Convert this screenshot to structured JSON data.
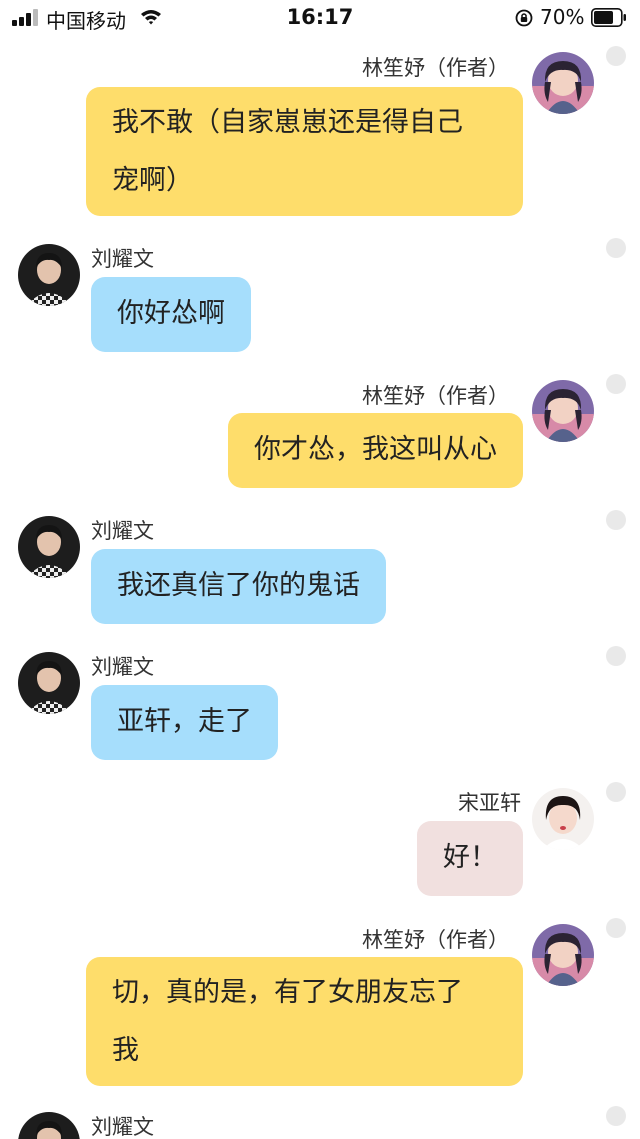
{
  "status_bar": {
    "carrier": "中国移动",
    "time": "16:17",
    "battery": "70%"
  },
  "colors": {
    "author_bubble": "#fedd6b",
    "liu_bubble": "#a6defc",
    "song_bubble": "#f1e0df"
  },
  "messages": [
    {
      "sender": "林笙妤（作者）",
      "text_lines": [
        "我不敢（自家崽崽还是得自己",
        "宠啊）"
      ],
      "side": "right"
    },
    {
      "sender": "刘耀文",
      "text": "你好怂啊",
      "side": "left"
    },
    {
      "sender": "林笙妤（作者）",
      "text": "你才怂，我这叫从心",
      "side": "right"
    },
    {
      "sender": "刘耀文",
      "text": "我还真信了你的鬼话",
      "side": "left"
    },
    {
      "sender": "刘耀文",
      "text": "亚轩，走了",
      "side": "left"
    },
    {
      "sender": "宋亚轩",
      "text": "好！",
      "side": "right"
    },
    {
      "sender": "林笙妤（作者）",
      "text_lines": [
        "切，真的是，有了女朋友忘了",
        "我"
      ],
      "side": "right"
    },
    {
      "sender": "刘耀文",
      "side": "left"
    }
  ]
}
